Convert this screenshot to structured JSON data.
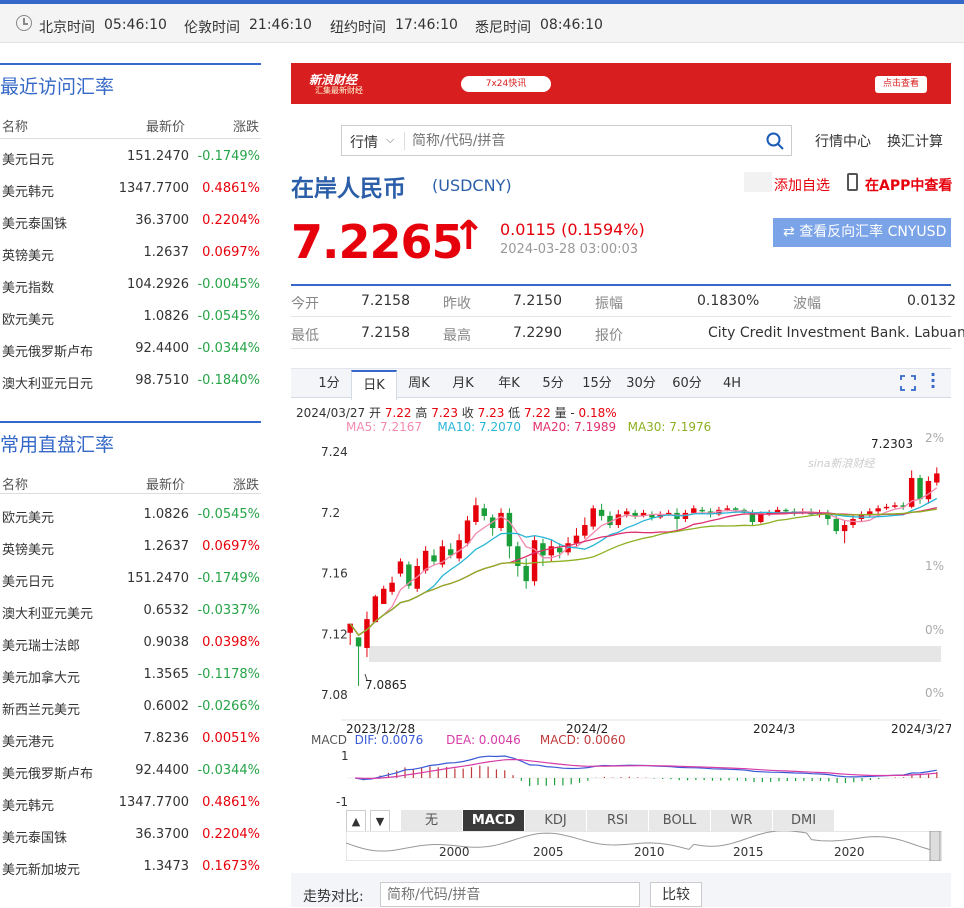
{
  "timebar": [
    {
      "city": "北京时间",
      "time": "05:46:10"
    },
    {
      "city": "伦敦时间",
      "time": "21:46:10"
    },
    {
      "city": "纽约时间",
      "time": "17:46:10"
    },
    {
      "city": "悉尼时间",
      "time": "08:46:10"
    }
  ],
  "recent": {
    "title": "最近访问汇率",
    "headers": [
      "名称",
      "最新价",
      "涨跌"
    ],
    "rows": [
      [
        "美元日元",
        "151.2470",
        "-0.1749%"
      ],
      [
        "美元韩元",
        "1347.7700",
        "0.4861%"
      ],
      [
        "美元泰国铢",
        "36.3700",
        "0.2204%"
      ],
      [
        "英镑美元",
        "1.2637",
        "0.0697%"
      ],
      [
        "美元指数",
        "104.2926",
        "-0.0045%"
      ],
      [
        "欧元美元",
        "1.0826",
        "-0.0545%"
      ],
      [
        "美元俄罗斯卢布",
        "92.4400",
        "-0.0344%"
      ],
      [
        "澳大利亚元日元",
        "98.7510",
        "-0.1840%"
      ]
    ]
  },
  "common": {
    "title": "常用直盘汇率",
    "headers": [
      "名称",
      "最新价",
      "涨跌"
    ],
    "rows": [
      [
        "欧元美元",
        "1.0826",
        "-0.0545%"
      ],
      [
        "英镑美元",
        "1.2637",
        "0.0697%"
      ],
      [
        "美元日元",
        "151.2470",
        "-0.1749%"
      ],
      [
        "澳大利亚元美元",
        "0.6532",
        "-0.0337%"
      ],
      [
        "美元瑞士法郎",
        "0.9038",
        "0.0398%"
      ],
      [
        "美元加拿大元",
        "1.3565",
        "-0.1178%"
      ],
      [
        "新西兰元美元",
        "0.6002",
        "-0.0266%"
      ],
      [
        "美元港元",
        "7.8236",
        "0.0051%"
      ],
      [
        "美元俄罗斯卢布",
        "92.4400",
        "-0.0344%"
      ],
      [
        "美元韩元",
        "1347.7700",
        "0.4861%"
      ],
      [
        "美元泰国铢",
        "36.3700",
        "0.2204%"
      ],
      [
        "美元新加坡元",
        "1.3473",
        "0.1673%"
      ]
    ]
  },
  "ad": {
    "brand": "新浪财经",
    "sub": "汇集最新财经",
    "badge": "7x24快讯",
    "cta": "点击查看"
  },
  "search": {
    "market": "行情",
    "placeholder": "简称/代码/拼音",
    "link1": "行情中心",
    "link2": "换汇计算"
  },
  "title": {
    "name": "在岸人民币",
    "code": "(USDCNY)",
    "add": "添加自选",
    "app": "在APP中查看"
  },
  "quote": {
    "price": "7.2265",
    "arrow": "↑",
    "change": "0.0115 (0.1594%)",
    "time": "2024-03-28 03:00:03",
    "reverse": "查看反向汇率 CNYUSD"
  },
  "stats": {
    "row1": [
      [
        "今开",
        "7.2158"
      ],
      [
        "昨收",
        "7.2150"
      ],
      [
        "振幅",
        "0.1830%"
      ],
      [
        "波幅",
        "0.0132"
      ]
    ],
    "row2": [
      [
        "最低",
        "7.2158"
      ],
      [
        "最高",
        "7.2290"
      ],
      [
        "报价",
        "City Credit Investment Bank. Labuan"
      ]
    ]
  },
  "ktabs": [
    "1分",
    "日K",
    "周K",
    "月K",
    "年K",
    "5分",
    "15分",
    "30分",
    "60分",
    "4H"
  ],
  "ohlc": {
    "date": "2024/03/27",
    "o_l": "开",
    "o": "7.22",
    "h_l": "高",
    "h": "7.23",
    "c_l": "收",
    "c": "7.23",
    "l_l": "低",
    "l": "7.22",
    "chg_l": "量 -",
    "chg": "0.18%"
  },
  "ma": {
    "ma5": "MA5: 7.2167",
    "ma10": "MA10: 7.2070",
    "ma20": "MA20: 7.1989",
    "ma30": "MA30: 7.1976"
  },
  "macd": {
    "label": "MACD",
    "dif": "DIF: 0.0076",
    "dea": "DEA: 0.0046",
    "macd": "MACD: 0.0060"
  },
  "indtabs": [
    "无",
    "MACD",
    "KDJ",
    "RSI",
    "BOLL",
    "WR",
    "DMI"
  ],
  "compare": {
    "label": "走势对比:",
    "placeholder": "简称/代码/拼音",
    "button": "比较"
  },
  "chart_data": {
    "type": "candlestick",
    "ylim": [
      7.08,
      7.25
    ],
    "yticks": [
      "7.24",
      "7.2",
      "7.16",
      "7.12",
      "7.08"
    ],
    "pct_ticks": [
      "2%",
      "1%",
      "0%",
      "0%"
    ],
    "xticks": [
      "2023/12/28",
      "2024/2",
      "2024/3",
      "2024/3/27"
    ],
    "max_label": "7.2303",
    "min_label": "7.0865",
    "macd_ticks": [
      "1",
      "-1"
    ],
    "nav_years": [
      "2000",
      "2005",
      "2010",
      "2015",
      "2020"
    ],
    "candles": [
      [
        7.121,
        7.127,
        7.112,
        7.113
      ],
      [
        7.118,
        7.112,
        7.097,
        7.086
      ],
      [
        7.111,
        7.13,
        7.135,
        7.105
      ],
      [
        7.128,
        7.145,
        7.146,
        7.128
      ],
      [
        7.14,
        7.15,
        7.152,
        7.14
      ],
      [
        7.148,
        7.154,
        7.158,
        7.146
      ],
      [
        7.16,
        7.168,
        7.17,
        7.158
      ],
      [
        7.166,
        7.152,
        7.168,
        7.15
      ],
      [
        7.15,
        7.165,
        7.17,
        7.148
      ],
      [
        7.162,
        7.175,
        7.178,
        7.16
      ],
      [
        7.172,
        7.168,
        7.176,
        7.166
      ],
      [
        7.166,
        7.178,
        7.182,
        7.164
      ],
      [
        7.176,
        7.172,
        7.18,
        7.17
      ],
      [
        7.17,
        7.182,
        7.186,
        7.168
      ],
      [
        7.18,
        7.195,
        7.198,
        7.178
      ],
      [
        7.194,
        7.205,
        7.21,
        7.192
      ],
      [
        7.203,
        7.198,
        7.206,
        7.195
      ],
      [
        7.197,
        7.19,
        7.199,
        7.185
      ],
      [
        7.19,
        7.2,
        7.203,
        7.188
      ],
      [
        7.2,
        7.178,
        7.203,
        7.17
      ],
      [
        7.178,
        7.165,
        7.181,
        7.158
      ],
      [
        7.165,
        7.155,
        7.17,
        7.15
      ],
      [
        7.155,
        7.182,
        7.185,
        7.152
      ],
      [
        7.18,
        7.172,
        7.183,
        7.165
      ],
      [
        7.172,
        7.178,
        7.182,
        7.168
      ],
      [
        7.177,
        7.174,
        7.18,
        7.17
      ],
      [
        7.174,
        7.18,
        7.184,
        7.172
      ],
      [
        7.18,
        7.185,
        7.19,
        7.178
      ],
      [
        7.185,
        7.192,
        7.197,
        7.183
      ],
      [
        7.191,
        7.203,
        7.205,
        7.189
      ],
      [
        7.202,
        7.198,
        7.206,
        7.195
      ],
      [
        7.198,
        7.192,
        7.201,
        7.19
      ],
      [
        7.192,
        7.199,
        7.202,
        7.19
      ],
      [
        7.199,
        7.201,
        7.203,
        7.197
      ],
      [
        7.2,
        7.198,
        7.202,
        7.196
      ],
      [
        7.198,
        7.2,
        7.202,
        7.197
      ],
      [
        7.199,
        7.197,
        7.201,
        7.195
      ],
      [
        7.197,
        7.199,
        7.201,
        7.196
      ],
      [
        7.199,
        7.2,
        7.202,
        7.198
      ],
      [
        7.2,
        7.196,
        7.203,
        7.189
      ],
      [
        7.196,
        7.2,
        7.202,
        7.194
      ],
      [
        7.2,
        7.203,
        7.205,
        7.199
      ],
      [
        7.202,
        7.201,
        7.204,
        7.199
      ],
      [
        7.201,
        7.199,
        7.203,
        7.197
      ],
      [
        7.199,
        7.202,
        7.204,
        7.198
      ],
      [
        7.202,
        7.203,
        7.205,
        7.201
      ],
      [
        7.203,
        7.202,
        7.204,
        7.2
      ],
      [
        7.202,
        7.2,
        7.203,
        7.199
      ],
      [
        7.2,
        7.194,
        7.202,
        7.192
      ],
      [
        7.194,
        7.199,
        7.201,
        7.193
      ],
      [
        7.199,
        7.2,
        7.202,
        7.198
      ],
      [
        7.2,
        7.202,
        7.204,
        7.199
      ],
      [
        7.202,
        7.201,
        7.203,
        7.199
      ],
      [
        7.201,
        7.2,
        7.203,
        7.198
      ],
      [
        7.2,
        7.201,
        7.203,
        7.199
      ],
      [
        7.201,
        7.199,
        7.203,
        7.198
      ],
      [
        7.199,
        7.2,
        7.202,
        7.197
      ],
      [
        7.2,
        7.196,
        7.202,
        7.192
      ],
      [
        7.196,
        7.188,
        7.198,
        7.186
      ],
      [
        7.188,
        7.192,
        7.195,
        7.18
      ],
      [
        7.192,
        7.196,
        7.199,
        7.19
      ],
      [
        7.196,
        7.199,
        7.201,
        7.194
      ],
      [
        7.199,
        7.201,
        7.203,
        7.197
      ],
      [
        7.201,
        7.203,
        7.205,
        7.199
      ],
      [
        7.203,
        7.204,
        7.206,
        7.202
      ],
      [
        7.204,
        7.205,
        7.207,
        7.203
      ],
      [
        7.205,
        7.204,
        7.207,
        7.202
      ],
      [
        7.204,
        7.223,
        7.228,
        7.203
      ],
      [
        7.223,
        7.209,
        7.225,
        7.206
      ],
      [
        7.209,
        7.221,
        7.224,
        7.206
      ],
      [
        7.22,
        7.226,
        7.23,
        7.218
      ]
    ]
  }
}
